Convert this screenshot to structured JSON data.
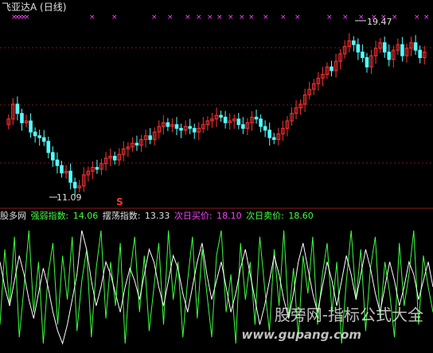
{
  "window": {
    "title": "飞亚达A (日线)"
  },
  "price_panel": {
    "high_label": "19.47",
    "low_label": "11.09",
    "signal_marker": "S",
    "price_range": [
      10.8,
      20.2
    ]
  },
  "indicator_panel": {
    "source": "股多网",
    "strength_label": "强弱指数: ",
    "strength_value": "14.06",
    "swing_label": "摆荡指数: ",
    "swing_value": "13.33",
    "next_buy_label": "次日买价: ",
    "next_buy_value": "18.10",
    "next_sell_label": "次日卖价: ",
    "next_sell_value": "18.60"
  },
  "watermark": {
    "cn": "股旁网-指标公式大全",
    "url": "www.gupang.com"
  },
  "colors": {
    "up_candle": "#ff3232",
    "down_candle": "#54ffff",
    "green_line": "#3cff3c",
    "white_line": "#ffffff",
    "grid": "#7a1a1a",
    "marker": "#ff40ff"
  },
  "chart_data": {
    "type": "candlestick",
    "title": "飞亚达A (日线)",
    "y_range": [
      10.8,
      20.2
    ],
    "annotated_high": 19.47,
    "annotated_low": 11.09,
    "close_series": [
      15.0,
      15.8,
      15.3,
      14.8,
      14.9,
      14.3,
      14.1,
      14.0,
      13.8,
      13.2,
      12.8,
      12.5,
      12.1,
      12.2,
      11.6,
      11.3,
      11.4,
      12.0,
      12.2,
      12.4,
      12.3,
      12.6,
      12.9,
      13.0,
      12.8,
      13.1,
      13.4,
      13.5,
      13.7,
      13.6,
      13.9,
      14.1,
      13.9,
      14.3,
      14.6,
      14.8,
      14.6,
      14.7,
      14.5,
      14.4,
      14.6,
      14.5,
      14.3,
      14.5,
      14.7,
      14.9,
      15.0,
      15.2,
      15.1,
      14.8,
      14.9,
      15.0,
      14.7,
      14.5,
      14.8,
      15.1,
      15.0,
      14.6,
      14.4,
      14.0,
      13.9,
      14.2,
      14.5,
      14.9,
      15.3,
      15.6,
      15.8,
      16.3,
      16.6,
      16.9,
      17.2,
      17.4,
      17.8,
      17.6,
      18.1,
      18.5,
      18.9,
      19.2,
      19.0,
      18.6,
      18.3,
      17.8,
      18.4,
      18.8,
      19.1,
      18.6,
      18.2,
      18.7,
      19.0,
      18.4,
      18.8,
      19.1,
      18.7,
      18.3,
      18.6
    ],
    "indicator_green": [
      0.2,
      0.8,
      0.35,
      0.9,
      0.1,
      0.5,
      0.95,
      0.3,
      0.7,
      0.05,
      0.6,
      0.85,
      0.2,
      0.75,
      0.4,
      0.9,
      0.15,
      0.55,
      0.8,
      0.1,
      0.65,
      0.95,
      0.25,
      0.7,
      0.35,
      0.85,
      0.05,
      0.6,
      0.9,
      0.3,
      0.75,
      0.15,
      0.5,
      0.85,
      0.2,
      0.95,
      0.4,
      0.7,
      0.1,
      0.55,
      0.9,
      0.25,
      0.8,
      0.45,
      0.1,
      0.75,
      0.95,
      0.3,
      0.6,
      0.05,
      0.85,
      0.4,
      0.7,
      0.2,
      0.9,
      0.5,
      0.15,
      0.8,
      0.35,
      0.95,
      0.25,
      0.65,
      0.1,
      0.75,
      0.45,
      0.9,
      0.2,
      0.6,
      0.85,
      0.3,
      0.7,
      0.05,
      0.55,
      0.95,
      0.4,
      0.8,
      0.15,
      0.65,
      0.9,
      0.25,
      0.7,
      0.45,
      0.1,
      0.85,
      0.35,
      0.6,
      0.95,
      0.2,
      0.75,
      0.5,
      0.3
    ],
    "indicator_white": [
      0.7,
      0.5,
      0.35,
      0.55,
      0.75,
      0.6,
      0.4,
      0.25,
      0.45,
      0.65,
      0.5,
      0.3,
      0.15,
      0.05,
      0.2,
      0.4,
      0.6,
      0.95,
      0.8,
      0.55,
      0.35,
      0.5,
      0.7,
      0.6,
      0.45,
      0.3,
      0.5,
      0.65,
      0.55,
      0.4,
      0.6,
      0.8,
      0.7,
      0.5,
      0.35,
      0.55,
      0.75,
      0.65,
      0.45,
      0.3,
      0.5,
      0.7,
      0.85,
      0.6,
      0.4,
      0.55,
      0.7,
      0.5,
      0.3,
      0.45,
      0.65,
      0.8,
      0.6,
      0.4,
      0.2,
      0.35,
      0.55,
      0.75,
      0.6,
      0.4,
      0.25,
      0.45,
      0.7,
      0.85,
      0.65,
      0.45,
      0.3,
      0.5,
      0.7,
      0.55,
      0.35,
      0.55,
      0.75,
      0.6,
      0.4,
      0.6,
      0.8,
      0.65,
      0.45,
      0.3,
      0.5,
      0.7,
      0.55,
      0.35,
      0.5,
      0.7,
      0.6,
      0.4,
      0.55,
      0.7,
      0.5
    ]
  }
}
